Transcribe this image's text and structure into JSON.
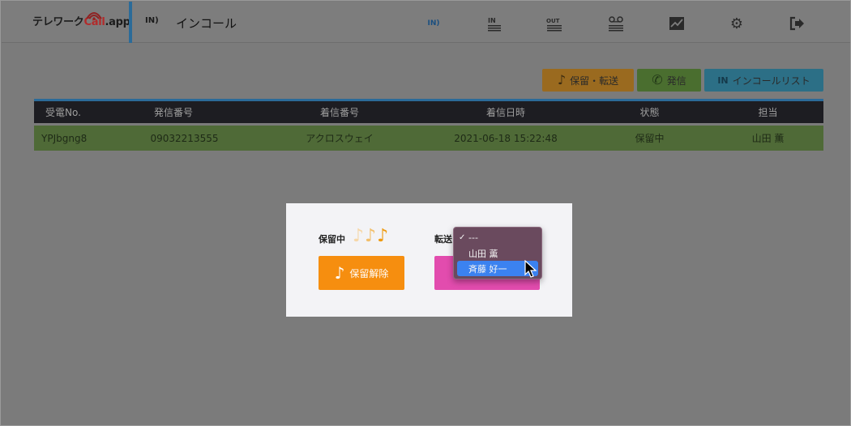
{
  "header": {
    "logo_text_a": "テレワーク",
    "logo_text_b": "Call",
    "logo_text_c": ".app",
    "page_icon": "IN",
    "page_title": "インコール",
    "nav": [
      {
        "name": "incoming",
        "label": "IN"
      },
      {
        "name": "incoming-list",
        "label": "IN"
      },
      {
        "name": "outgoing-list",
        "label": "OUT"
      },
      {
        "name": "voicemail",
        "label": "oo"
      },
      {
        "name": "analytics",
        "label": "~"
      },
      {
        "name": "settings",
        "label": "⚙"
      },
      {
        "name": "logout",
        "label": "⇥"
      }
    ]
  },
  "actions": {
    "hold_transfer_label": "保留・転送",
    "dial_label": "発信",
    "incall_list_label": "インコールリスト",
    "list_icon": "IN"
  },
  "table": {
    "headers": [
      "受電No.",
      "発信番号",
      "着信番号",
      "着信日時",
      "状態",
      "担当"
    ],
    "rows": [
      [
        "YPJbgng8",
        "09032213555",
        "アクロスウェイ",
        "2021-06-18 15:22:48",
        "保留中",
        "山田 薫"
      ]
    ]
  },
  "modal": {
    "hold_label": "保留中",
    "release_label": "保留解除",
    "transfer_label": "転送"
  },
  "dropdown": {
    "options": [
      "---",
      "山田 薫",
      "斉藤 好一"
    ],
    "checked_option": "---",
    "highlighted_option": "斉藤 好一"
  },
  "colors": {
    "accent_blue": "#2b6b99",
    "hold_orange": "#f68e0f",
    "transfer_pink": "#e24cae",
    "row_green": "#4f6a37",
    "dropdown_highlight": "#3b82f0"
  }
}
